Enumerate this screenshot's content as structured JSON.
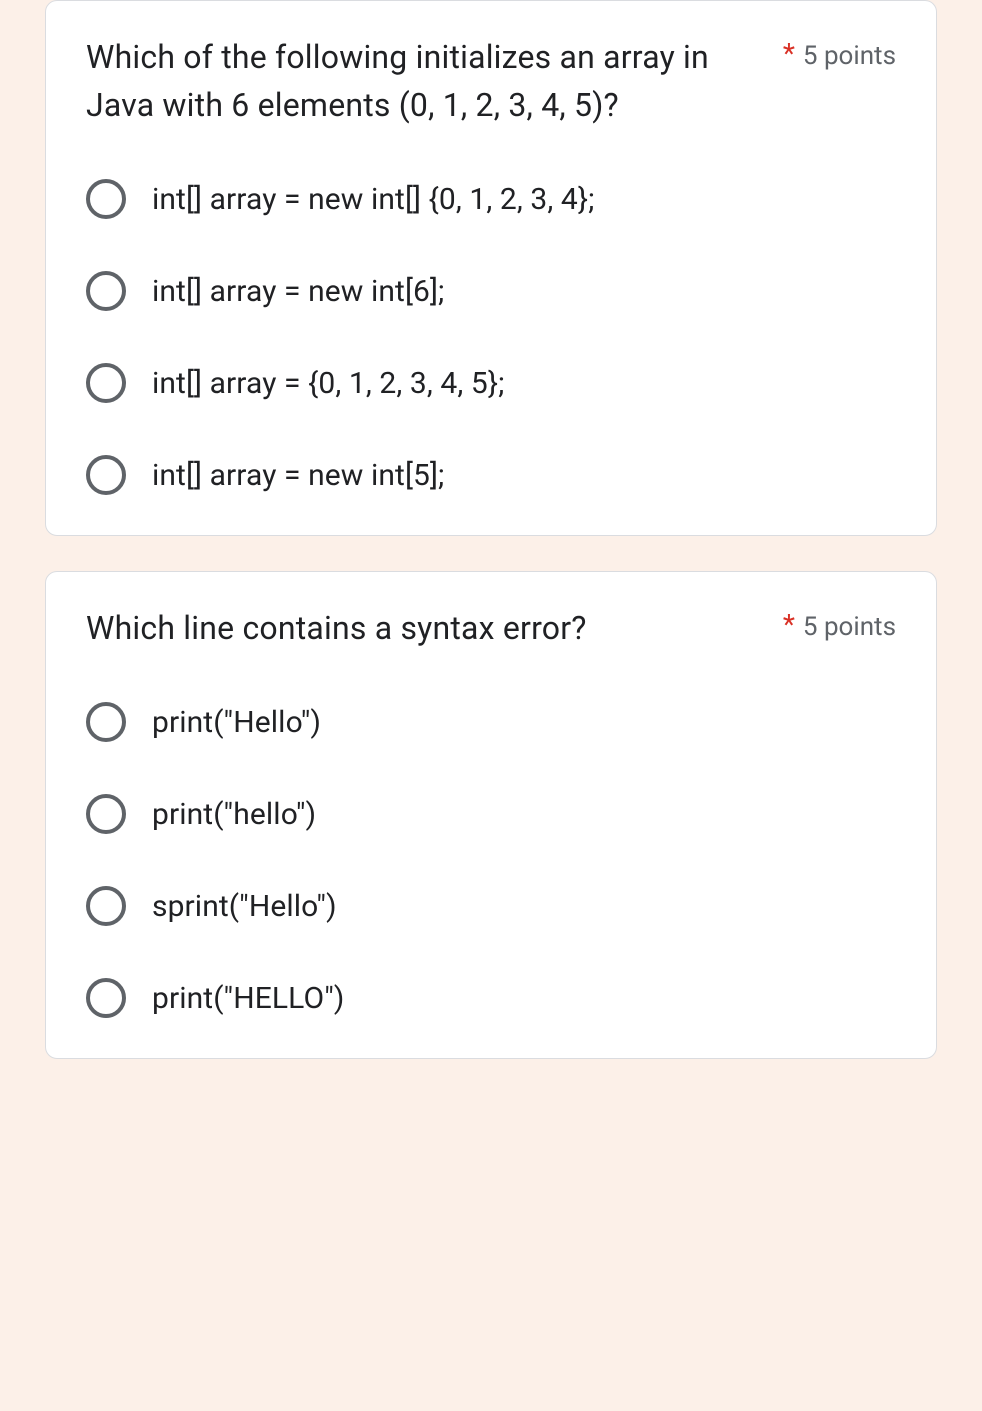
{
  "questions": [
    {
      "text": "Which of the following initializes an array in Java with 6 elements (0, 1, 2, 3, 4, 5)?",
      "points": "5 points",
      "options": [
        "int[] array = new int[] {0, 1, 2, 3, 4};",
        "int[] array = new int[6];",
        "int[] array = {0, 1, 2, 3, 4, 5};",
        "int[] array = new int[5];"
      ]
    },
    {
      "text": "Which line contains a syntax error?",
      "points": "5 points",
      "options": [
        "print(\"Hello\")",
        "print(\"hello\")",
        "sprint(\"Hello\")",
        "print(\"HELLO\")"
      ]
    }
  ]
}
